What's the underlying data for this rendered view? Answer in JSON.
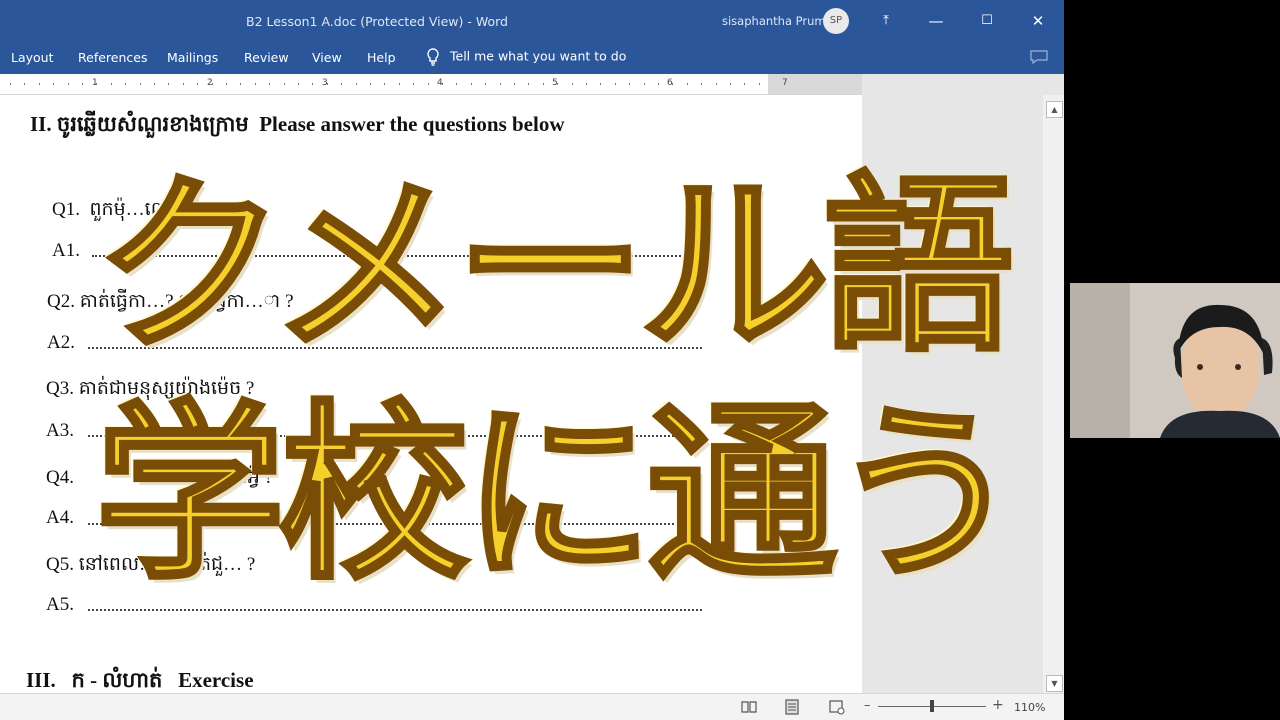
{
  "window": {
    "title": "B2 Lesson1 A.doc (Protected View)  -  Word",
    "user_name": "sisaphantha Prum",
    "user_initials": "SP",
    "controls": {
      "restore_ribbon": "⤒",
      "minimize": "—",
      "maximize": "☐",
      "close": "✕"
    }
  },
  "ribbon": {
    "tabs": [
      "Layout",
      "References",
      "Mailings",
      "Review",
      "View",
      "Help"
    ],
    "tell_me": "Tell me what you want to do"
  },
  "ruler": {
    "numbers": [
      "1",
      "2",
      "3",
      "4",
      "5",
      "6",
      "7"
    ]
  },
  "document": {
    "heading2_num": "II.",
    "heading2_km": "ចូរឆ្លើយសំណួរខាងក្រោម",
    "heading2_en": "Please answer the questions below",
    "questions": [
      {
        "q_label": "Q1.",
        "q_text": "ពួកម៉ុ…​ឈ្មោះអ្វី ?",
        "a_label": "A1."
      },
      {
        "q_label": "Q2.",
        "q_text": "គាត់ធ្វើកា…? គាត់ធ្វើកា…​ា ?",
        "a_label": "A2."
      },
      {
        "q_label": "Q3.",
        "q_text": "គាត់ជាមនុស្សយ៉ាងម៉េច ?",
        "a_label": "A3."
      },
      {
        "q_label": "Q4.",
        "q_text": "…​​អ្វី ?",
        "a_label": "A4."
      },
      {
        "q_label": "Q5.",
        "q_text": "នៅពេល…​នរ គាត់ជួ…​ ?",
        "a_label": "A5."
      }
    ],
    "heading3_num": "III.",
    "heading3_km": "ក -  លំហាត់",
    "heading3_en": "Exercise"
  },
  "statusbar": {
    "zoom": "110%",
    "zoom_minus": "–",
    "zoom_plus": "+",
    "zoom_percent": 110
  },
  "overlay": {
    "line1": "クメール語",
    "line2": "学校に通う"
  },
  "colors": {
    "word_blue": "#2b579a",
    "overlay_gold": "#f6d02a",
    "overlay_outline": "#7a4d06"
  }
}
